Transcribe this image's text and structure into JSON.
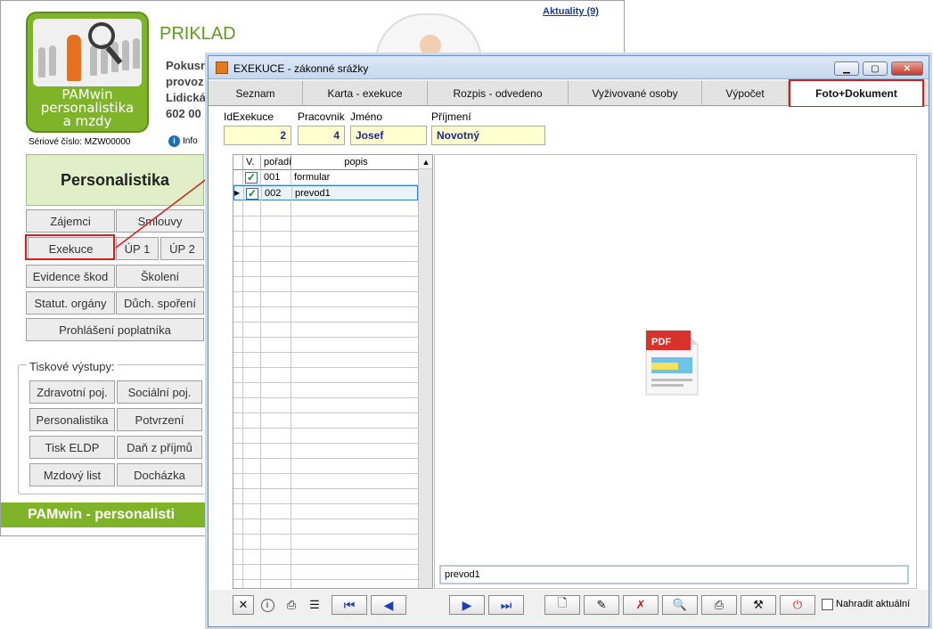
{
  "main": {
    "news_link": "Aktuality (9)",
    "logo": {
      "line1": "PAMwin",
      "line2": "personalistika",
      "line3": "a mzdy"
    },
    "company_title": "PRIKLAD",
    "company_lines": [
      "Pokusn",
      "provoz",
      "Lidická",
      "602 00"
    ],
    "serial": "Sériové číslo: MZW00000",
    "info": "Info",
    "section_button": "Personalistika",
    "buttons": {
      "zajemci": "Zájemci",
      "smlouvy": "Smlouvy",
      "exekuce": "Exekuce",
      "up1": "ÚP 1",
      "up2": "ÚP 2",
      "evidence": "Evidence škod",
      "skoleni": "Školení",
      "statut": "Statut. orgány",
      "duch": "Důch. spoření",
      "prohlaseni": "Prohlášení poplatníka"
    },
    "print_group": {
      "legend": "Tiskové výstupy:",
      "zdravotni": "Zdravotní poj.",
      "socialni": "Sociální poj.",
      "personalistika": "Personalistika",
      "potvrzeni": "Potvrzení",
      "eldp": "Tisk ELDP",
      "dan": "Daň z příjmů",
      "mzdovy": "Mzdový list",
      "dochazka": "Docházka"
    },
    "footer": "PAMwin - personalisti"
  },
  "dialog": {
    "title": "EXEKUCE - zákonné srážky",
    "tabs": [
      "Seznam",
      "Karta - exekuce",
      "Rozpis - odvedeno",
      "Vyživované osoby",
      "Výpočet",
      "Foto+Dokument"
    ],
    "active_tab": "Foto+Dokument",
    "fields": {
      "id_label": "IdExekuce",
      "id_value": "2",
      "prac_label": "Pracovnik",
      "prac_value": "4",
      "jmeno_label": "Jméno",
      "jmeno_value": "Josef",
      "prijmeni_label": "Příjmení",
      "prijmeni_value": "Novotný"
    },
    "grid": {
      "headers": [
        "V.",
        "pořadí",
        "popis"
      ],
      "rows": [
        {
          "checked": true,
          "poradi": "001",
          "popis": "formular"
        },
        {
          "checked": true,
          "poradi": "002",
          "popis": "prevod1"
        }
      ]
    },
    "preview": {
      "icon": "pdf-file-icon",
      "icon_text": "PDF",
      "filename": "prevod1"
    },
    "toolbar": {
      "replace_label": "Nahradit aktuální"
    }
  },
  "colors": {
    "brand_green": "#7fb42a",
    "highlight_red": "#d21f1f",
    "field_yellow": "#ffffd0"
  }
}
